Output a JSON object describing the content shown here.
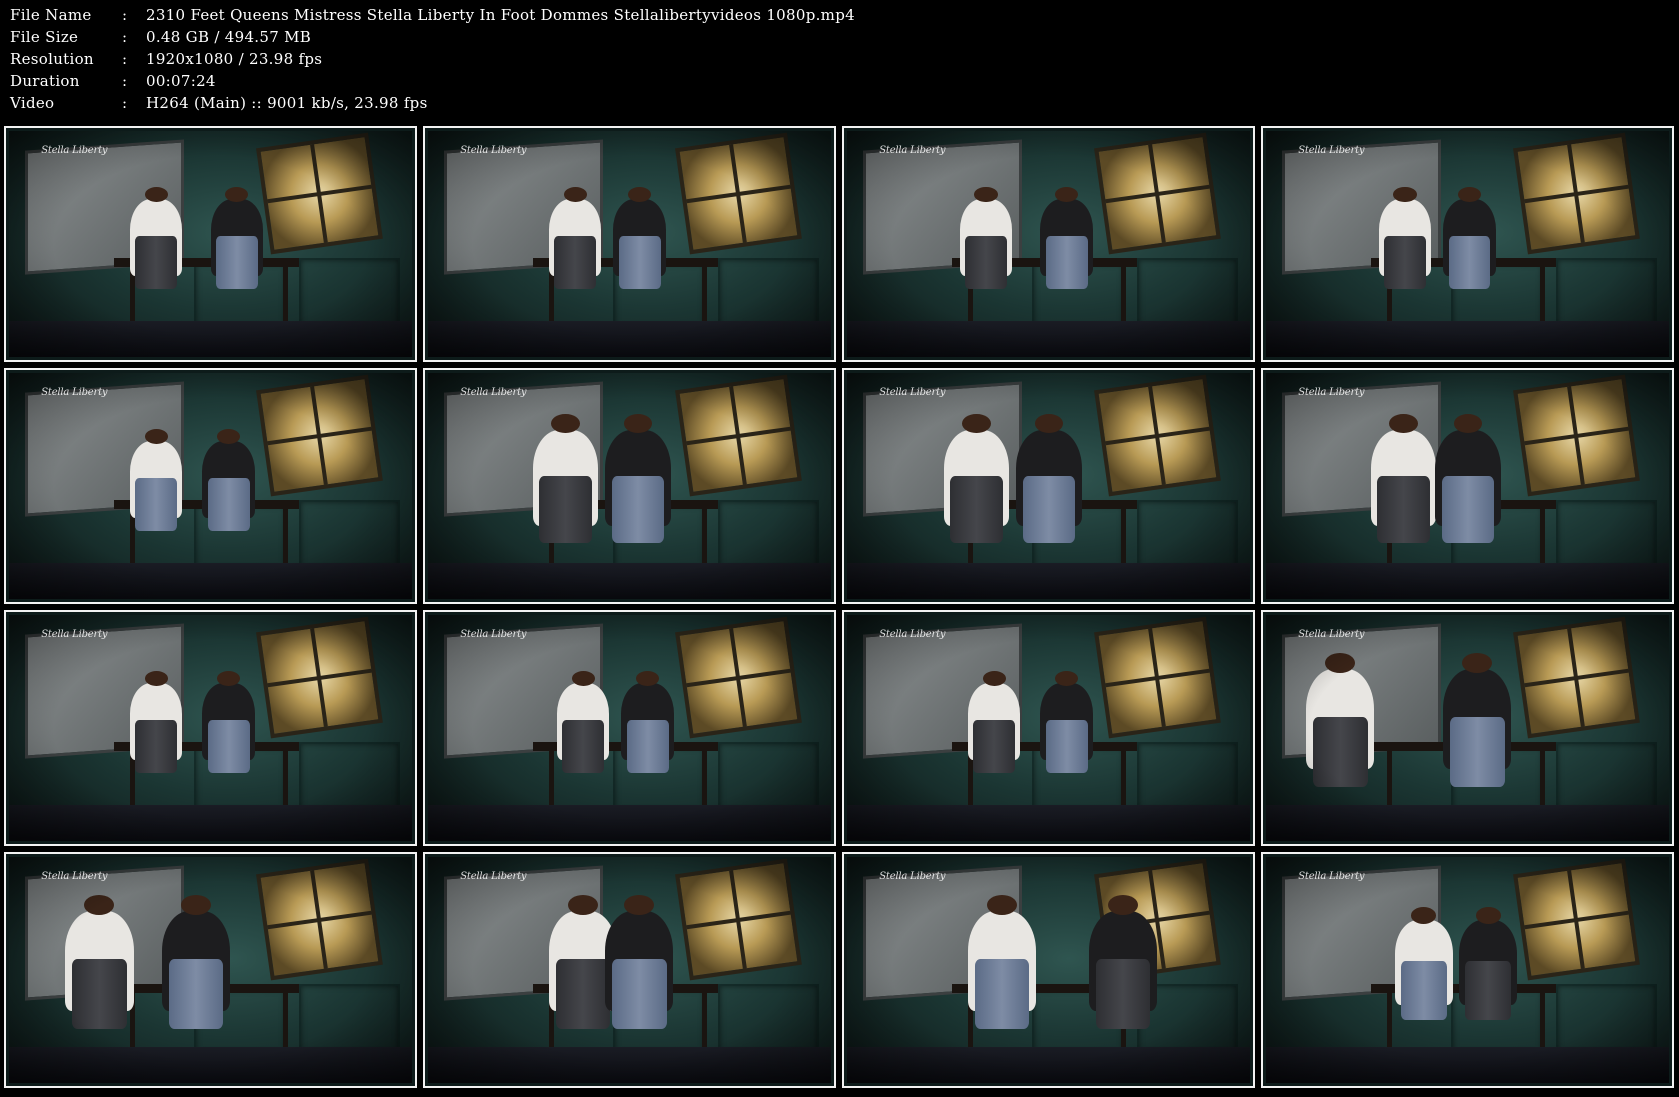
{
  "info": {
    "rows": [
      {
        "label": "File Name",
        "value": "2310 Feet Queens Mistress Stella Liberty In Foot Dommes Stellalibertyvideos 1080p.mp4"
      },
      {
        "label": "File Size",
        "value": "0.48 GB  / 494.57 MB"
      },
      {
        "label": "Resolution",
        "value": "1920x1080 / 23.98 fps"
      },
      {
        "label": "Duration",
        "value": "00:07:24"
      },
      {
        "label": "Video",
        "value": "H264 (Main) :: 9001 kb/s, 23.98 fps"
      }
    ],
    "separator": ":"
  },
  "thumbnails": {
    "watermark": "Stella Liberty",
    "count": 16,
    "columns": 4,
    "rows": 4
  },
  "colors": {
    "background": "#000000",
    "text": "#ffffff",
    "thumb_border": "#f2f2f2",
    "wall": "#1b3633",
    "jeans": "#7e8ca5",
    "dark_pants": "#45464b"
  }
}
